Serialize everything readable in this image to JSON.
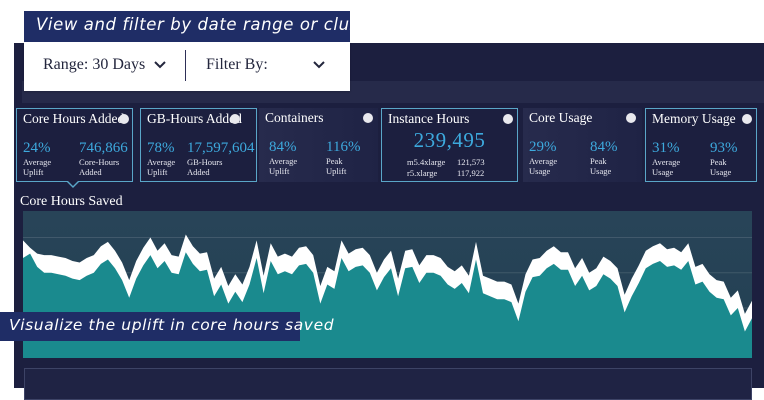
{
  "callouts": {
    "top": "View and filter by date range or cluster",
    "bottom": "Visualize the uplift in core hours saved"
  },
  "filters": {
    "range_label": "Range: 30 Days",
    "filter_label": "Filter By:"
  },
  "cards": {
    "core_hours_added": {
      "title": "Core Hours Added",
      "left_value": "24%",
      "left_label": "Average\nUplift",
      "right_value": "746,866",
      "right_label": "Core-Hours\nAdded"
    },
    "gb_hours_added": {
      "title": "GB-Hours Added",
      "left_value": "78%",
      "left_label": "Average\nUplift",
      "right_value": "17,597,604",
      "right_label": "GB-Hours\nAdded"
    },
    "containers": {
      "title": "Containers",
      "left_value": "84%",
      "left_label": "Average\nUplift",
      "right_value": "116%",
      "right_label": "Peak\nUplift"
    },
    "instance_hours": {
      "title": "Instance Hours",
      "total": "239,495",
      "rows": [
        {
          "name": "m5.4xlarge",
          "value": "121,573"
        },
        {
          "name": "r5.xlarge",
          "value": "117,922"
        }
      ]
    },
    "core_usage": {
      "title": "Core Usage",
      "left_value": "29%",
      "left_label": "Average\nUsage",
      "right_value": "84%",
      "right_label": "Peak\nUsage"
    },
    "memory_usage": {
      "title": "Memory Usage",
      "left_value": "31%",
      "left_label": "Average\nUsage",
      "right_value": "93%",
      "right_label": "Peak\nUsage"
    }
  },
  "section": {
    "title": "Core Hours Saved"
  },
  "colors": {
    "accent": "#3da9dd",
    "area_fill": "#1a8a8e",
    "panel": "#1c1f3f",
    "callout": "#1f2d66"
  },
  "chart_data": {
    "type": "area",
    "series": [
      {
        "values": [
          0.68,
          0.71,
          0.62,
          0.58,
          0.58,
          0.57,
          0.56,
          0.54,
          0.53,
          0.56,
          0.58,
          0.64,
          0.67,
          0.61,
          0.53,
          0.41,
          0.54,
          0.63,
          0.7,
          0.61,
          0.66,
          0.58,
          0.57,
          0.72,
          0.64,
          0.59,
          0.6,
          0.42,
          0.5,
          0.37,
          0.45,
          0.38,
          0.5,
          0.68,
          0.44,
          0.66,
          0.57,
          0.59,
          0.57,
          0.63,
          0.64,
          0.58,
          0.37,
          0.5,
          0.47,
          0.68,
          0.59,
          0.62,
          0.63,
          0.58,
          0.46,
          0.55,
          0.61,
          0.42,
          0.61,
          0.62,
          0.51,
          0.58,
          0.58,
          0.56,
          0.5,
          0.47,
          0.51,
          0.44,
          0.67,
          0.44,
          0.42,
          0.4,
          0.4,
          0.38,
          0.25,
          0.45,
          0.55,
          0.56,
          0.61,
          0.64,
          0.6,
          0.6,
          0.49,
          0.56,
          0.46,
          0.49,
          0.57,
          0.54,
          0.49,
          0.31,
          0.42,
          0.51,
          0.61,
          0.64,
          0.66,
          0.62,
          0.63,
          0.6,
          0.66,
          0.5,
          0.52,
          0.45,
          0.41,
          0.4,
          0.29,
          0.34,
          0.18,
          0.27
        ]
      },
      {
        "values": [
          0.8,
          0.75,
          0.71,
          0.7,
          0.7,
          0.69,
          0.68,
          0.66,
          0.65,
          0.68,
          0.7,
          0.76,
          0.79,
          0.73,
          0.65,
          0.53,
          0.66,
          0.75,
          0.82,
          0.73,
          0.78,
          0.7,
          0.69,
          0.84,
          0.76,
          0.71,
          0.72,
          0.54,
          0.62,
          0.49,
          0.57,
          0.5,
          0.62,
          0.8,
          0.56,
          0.78,
          0.69,
          0.71,
          0.69,
          0.75,
          0.76,
          0.7,
          0.49,
          0.62,
          0.59,
          0.8,
          0.71,
          0.74,
          0.75,
          0.7,
          0.58,
          0.67,
          0.73,
          0.54,
          0.73,
          0.74,
          0.63,
          0.7,
          0.7,
          0.68,
          0.62,
          0.59,
          0.63,
          0.56,
          0.79,
          0.56,
          0.54,
          0.52,
          0.52,
          0.5,
          0.37,
          0.57,
          0.67,
          0.68,
          0.73,
          0.76,
          0.72,
          0.72,
          0.61,
          0.68,
          0.58,
          0.61,
          0.69,
          0.66,
          0.61,
          0.43,
          0.54,
          0.63,
          0.73,
          0.76,
          0.78,
          0.74,
          0.75,
          0.72,
          0.78,
          0.62,
          0.64,
          0.57,
          0.53,
          0.52,
          0.41,
          0.46,
          0.3,
          0.39
        ]
      }
    ],
    "ylim": [
      0,
      1
    ],
    "grid": true
  }
}
